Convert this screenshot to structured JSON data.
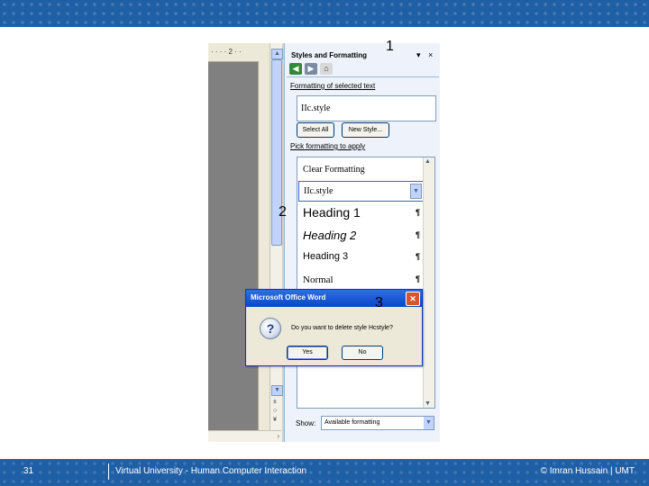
{
  "slide": {
    "number": "31",
    "footer_title": "Virtual University - Human Computer Interaction",
    "footer_credit": "© Imran Hussain | UMT"
  },
  "callouts": [
    "1",
    "2",
    "3"
  ],
  "doc": {
    "ruler_text": "· · · · 2 · ·"
  },
  "pane": {
    "title": "Styles and Formatting",
    "dropdown_glyph": "▾",
    "close_glyph": "×",
    "tool_icons": [
      "back-icon",
      "forward-icon",
      "home-icon"
    ],
    "formatting_label": "Formatting of selected text",
    "selected_style": "IIc.style",
    "select_all_label": "Select All",
    "new_style_label": "New Style...",
    "pick_label": "Pick formatting to apply",
    "styles": [
      {
        "label": "Clear Formatting"
      },
      {
        "label": "IIc.style"
      },
      {
        "label": "Heading 1"
      },
      {
        "label": "Heading 2"
      },
      {
        "label": "Heading 3"
      },
      {
        "label": "Normal"
      }
    ],
    "pilcrow": "¶",
    "show_label": "Show:",
    "show_value": "Available formatting"
  },
  "dialog": {
    "title": "Microsoft Office Word",
    "message": "Do you want to delete style Hcstyle?",
    "yes_label": "Yes",
    "no_label": "No",
    "icon": "question-icon"
  }
}
